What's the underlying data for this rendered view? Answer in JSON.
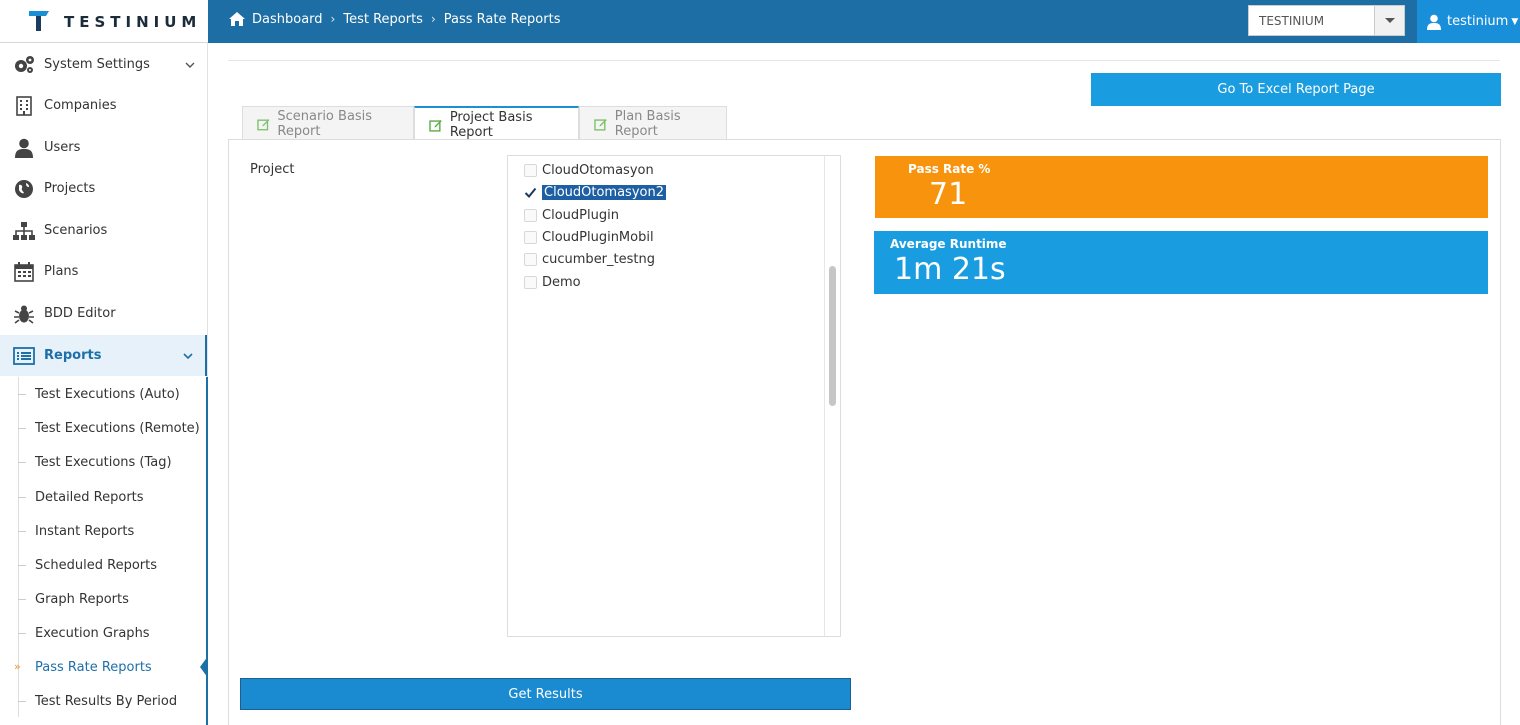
{
  "header": {
    "logo_text": "TESTINIUM",
    "breadcrumb": [
      "Dashboard",
      "Test Reports",
      "Pass Rate Reports"
    ],
    "company_select": "TESTINIUM",
    "user_name": "testinium"
  },
  "sidebar": {
    "items": [
      {
        "label": "System Settings",
        "icon": "gears-icon"
      },
      {
        "label": "Companies",
        "icon": "building-icon"
      },
      {
        "label": "Users",
        "icon": "user-icon"
      },
      {
        "label": "Projects",
        "icon": "globe-icon"
      },
      {
        "label": "Scenarios",
        "icon": "sitemap-icon"
      },
      {
        "label": "Plans",
        "icon": "calendar-icon"
      },
      {
        "label": "BDD Editor",
        "icon": "bug-icon"
      },
      {
        "label": "Reports",
        "icon": "report-list-icon"
      }
    ],
    "sub_items": [
      "Test Executions (Auto)",
      "Test Executions (Remote)",
      "Test Executions (Tag)",
      "Detailed Reports",
      "Instant Reports",
      "Scheduled Reports",
      "Graph Reports",
      "Execution Graphs",
      "Pass Rate Reports",
      "Test Results By Period"
    ]
  },
  "main": {
    "excel_button": "Go To Excel Report Page",
    "tabs": [
      "Scenario Basis Report",
      "Project Basis Report",
      "Plan Basis Report"
    ],
    "active_tab": "Project Basis Report",
    "project_label": "Project",
    "projects": [
      {
        "name": "CloudOtomasyon",
        "checked": false
      },
      {
        "name": "CloudOtomasyon2",
        "checked": true
      },
      {
        "name": "CloudPlugin",
        "checked": false
      },
      {
        "name": "CloudPluginMobil",
        "checked": false
      },
      {
        "name": "cucumber_testng",
        "checked": false
      },
      {
        "name": "Demo",
        "checked": false
      }
    ],
    "pass_rate": {
      "label": "Pass Rate %",
      "value": "71"
    },
    "average_runtime": {
      "label": "Average Runtime",
      "value": "1m 21s"
    },
    "get_results_button": "Get Results"
  },
  "colors": {
    "header_bg": "#1c6ea4",
    "accent": "#1a9de0",
    "pass_rate_bg": "#f7930d",
    "active_nav": "#1d6fa8"
  }
}
